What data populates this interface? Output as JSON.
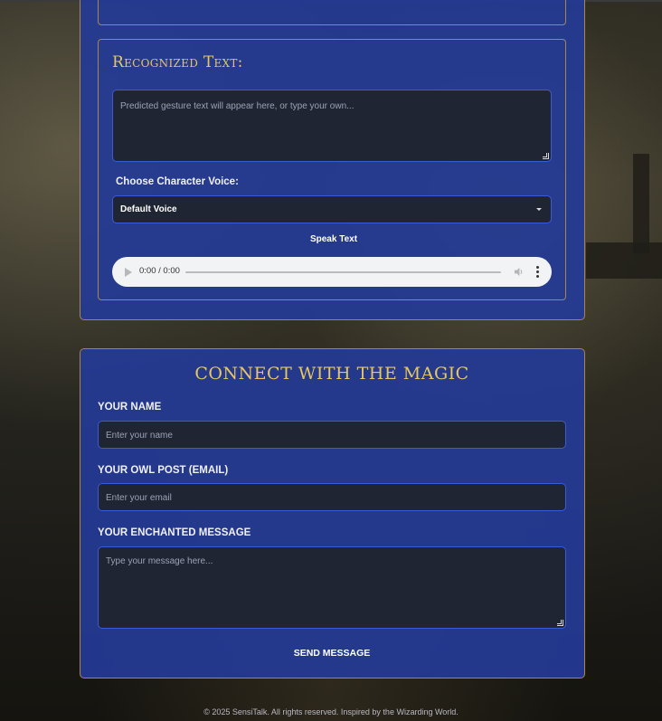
{
  "recognition": {
    "heading": "Recognized Text:",
    "text_placeholder": "Predicted gesture text will appear here, or type your own...",
    "voice_label": "Choose Character Voice:",
    "voice_selected": "Default Voice",
    "speak_label": "Speak Text",
    "audio_time": "0:00 / 0:00"
  },
  "contact": {
    "title": "CONNECT WITH THE MAGIC",
    "name_label": "YOUR NAME",
    "name_placeholder": "Enter your name",
    "email_label": "YOUR OWL POST (EMAIL)",
    "email_placeholder": "Enter your email",
    "message_label": "YOUR ENCHANTED MESSAGE",
    "message_placeholder": "Type your message here...",
    "send_label": "SEND MESSAGE"
  },
  "footer": {
    "text": "© 2025 SensiTalk. All rights reserved. Inspired by the Wizarding World."
  },
  "colors": {
    "panel": "#243b96",
    "border": "#a8864e",
    "heading": "#e6c665",
    "field": "#1f2533",
    "field_border": "#3b5bd6"
  }
}
